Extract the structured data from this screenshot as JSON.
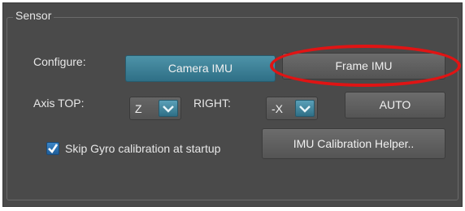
{
  "group": {
    "title": "Sensor"
  },
  "configure": {
    "label": "Configure:",
    "camera_imu": "Camera IMU",
    "frame_imu": "Frame IMU"
  },
  "axis": {
    "top_label": "Axis TOP:",
    "top_value": "Z",
    "right_label": "RIGHT:",
    "right_value": "-X",
    "auto": "AUTO"
  },
  "calibration": {
    "skip_gyro_label": "Skip Gyro calibration at startup",
    "skip_gyro_checked": true,
    "helper_button": "IMU Calibration Helper.."
  },
  "annotation": {
    "highlight_color": "#e01414"
  },
  "colors": {
    "active_button": "#3c829a",
    "panel": "#4a4a4a"
  }
}
